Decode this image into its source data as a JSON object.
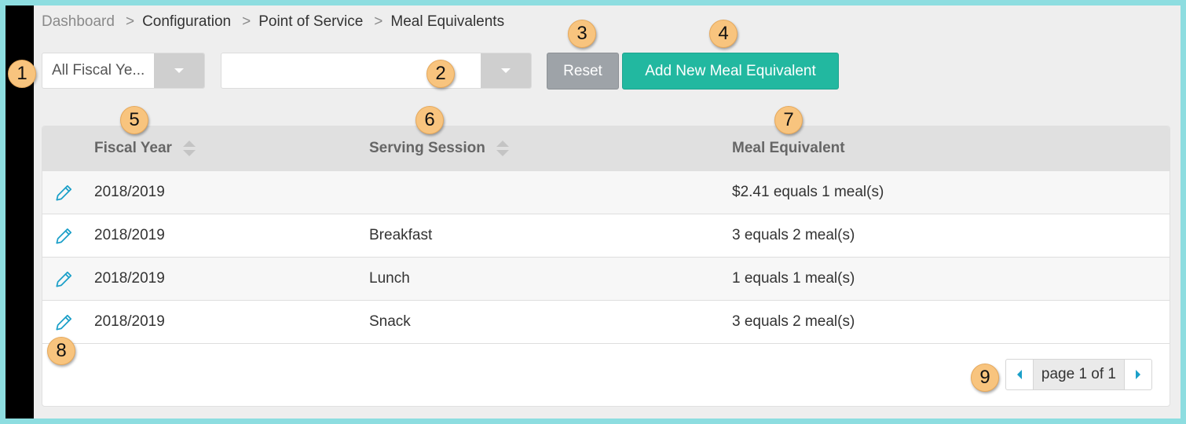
{
  "breadcrumb": [
    "Dashboard",
    "Configuration",
    "Point of Service",
    "Meal Equivalents"
  ],
  "breadcrumb_separator": ">",
  "filters": {
    "fiscal_year_value": "All Fiscal Ye...",
    "serving_session_value": ""
  },
  "buttons": {
    "reset_label": "Reset",
    "add_label": "Add New Meal Equivalent"
  },
  "table": {
    "headers": {
      "fiscal_year": "Fiscal Year",
      "serving_session": "Serving Session",
      "meal_equivalent": "Meal Equivalent"
    },
    "rows": [
      {
        "fiscal_year": "2018/2019",
        "serving_session": "",
        "meal_equivalent": "$2.41 equals 1 meal(s)"
      },
      {
        "fiscal_year": "2018/2019",
        "serving_session": "Breakfast",
        "meal_equivalent": "3 equals 2 meal(s)"
      },
      {
        "fiscal_year": "2018/2019",
        "serving_session": "Lunch",
        "meal_equivalent": "1 equals 1 meal(s)"
      },
      {
        "fiscal_year": "2018/2019",
        "serving_session": "Snack",
        "meal_equivalent": "3 equals 2 meal(s)"
      }
    ]
  },
  "pagination": {
    "label": "page 1 of 1"
  },
  "callouts": [
    "1",
    "2",
    "3",
    "4",
    "5",
    "6",
    "7",
    "8",
    "9"
  ],
  "icons": {
    "edit": "pencil-icon",
    "sort": "sort-icon",
    "dropdown": "caret-down-icon",
    "prev": "caret-left-icon",
    "next": "caret-right-icon"
  },
  "colors": {
    "accent": "#22b8a0",
    "reset": "#9ea3a8",
    "link": "#1a9fc8",
    "callout": "#f8c47e",
    "border_frame": "#8ddde0"
  }
}
